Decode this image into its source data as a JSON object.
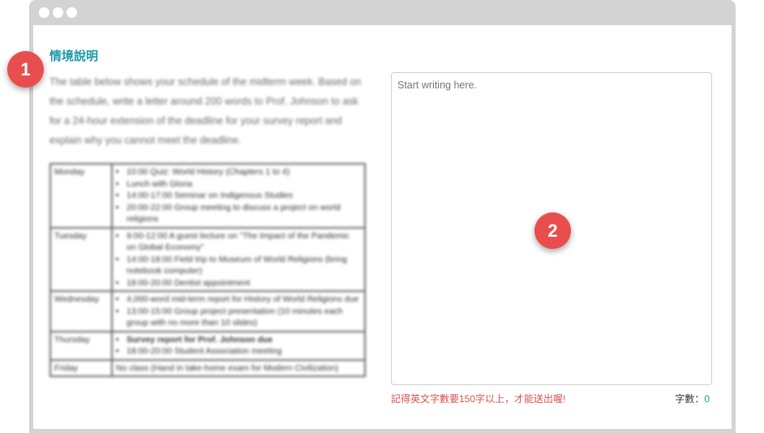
{
  "section_title": "情境說明",
  "description": "The table below shows your schedule of the midterm week. Based on the schedule, write a letter around 200 words to Prof. Johnson to ask for a 24-hour extension of the deadline for your survey report and explain why you cannot meet the deadline.",
  "schedule": [
    {
      "day": "Monday",
      "items": [
        "10:00 Quiz: World History (Chapters 1 to 4)",
        "Lunch with Gloria",
        "14:00-17:00 Seminar on Indigenous Studies",
        "20:00-22:00 Group meeting to discuss a project on world religions"
      ]
    },
    {
      "day": "Tuesday",
      "items": [
        "9:00-12:00 A guest lecture on \"The Impact of the Pandemic on Global Economy\"",
        "14:00-18:00 Field trip to Museum of World Religions (bring notebook computer)",
        "18:00-20:00 Dentist appointment"
      ]
    },
    {
      "day": "Wednesday",
      "items": [
        "4,000-word mid-term report for History of World Religions due",
        "13:00-15:00 Group project presentation (10 minutes each group with no more than 10 slides)"
      ]
    },
    {
      "day": "Thursday",
      "items": [
        "Survey report for Prof. Johnson due",
        "18:00-20:00 Student Association meeting"
      ]
    },
    {
      "day": "Friday",
      "text": "No class (Hand in take-home exam for Modern Civilization)"
    }
  ],
  "editor": {
    "placeholder": "Start writing here."
  },
  "warning": "記得英文字數要150字以上，才能送出喔!",
  "word_count": {
    "label": "字數：",
    "value": "0"
  },
  "badges": [
    "1",
    "2"
  ]
}
